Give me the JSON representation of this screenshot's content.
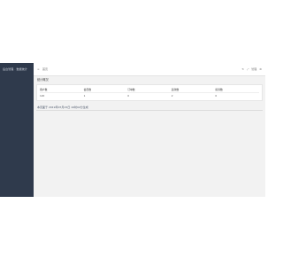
{
  "sidebar": {
    "title": "后台管理 · 数据统计"
  },
  "topbar": {
    "menu_icon": "menu-icon",
    "home_label": "首页",
    "actions": [
      {
        "icon": "refresh-icon",
        "label": "↻"
      },
      {
        "icon": "fullscreen-icon",
        "label": "⤢"
      },
      {
        "icon": "user-icon",
        "label": "管理"
      },
      {
        "icon": "gear-icon",
        "label": "⚙"
      }
    ]
  },
  "main": {
    "section_title": "统计概况",
    "table": {
      "headers": [
        "用户数",
        "会员数",
        "订单数",
        "退款数",
        "投诉数"
      ],
      "rows": [
        [
          "120",
          "1",
          "0",
          "2",
          "0"
        ]
      ]
    },
    "footer_note": "本页面于 2019年07月15日 16时02分生成"
  }
}
